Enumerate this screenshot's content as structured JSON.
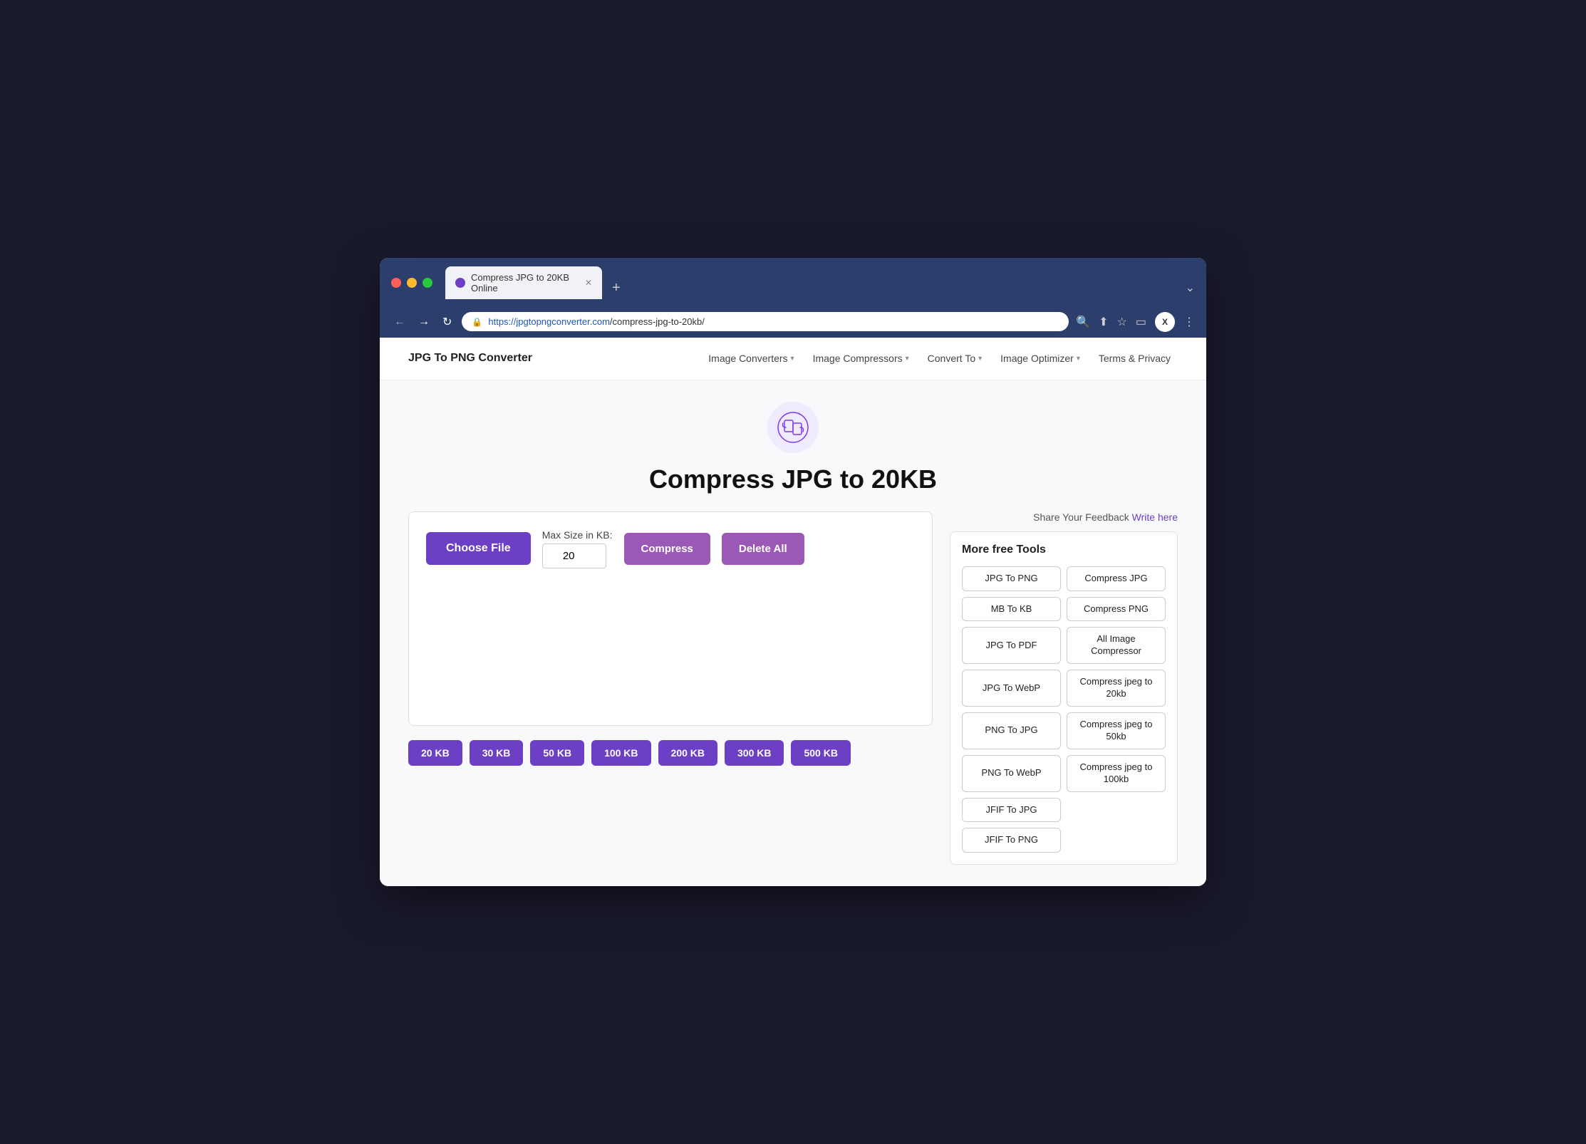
{
  "browser": {
    "tab_title": "Compress JPG to 20KB Online",
    "url_prefix": "https://jpgtopngconverter.com",
    "url_path": "/compress-jpg-to-20kb/",
    "new_tab_label": "+",
    "chevron": "⌄"
  },
  "navbar": {
    "brand": "JPG To PNG Converter",
    "menu_items": [
      {
        "label": "Image Converters",
        "has_dropdown": true
      },
      {
        "label": "Image Compressors",
        "has_dropdown": true
      },
      {
        "label": "Convert To",
        "has_dropdown": true
      },
      {
        "label": "Image Optimizer",
        "has_dropdown": true
      },
      {
        "label": "Terms & Privacy",
        "has_dropdown": false
      }
    ]
  },
  "page": {
    "title": "Compress JPG to 20KB",
    "feedback_text": "Share Your Feedback ",
    "feedback_link": "Write here"
  },
  "converter": {
    "choose_file_label": "Choose File",
    "max_size_label": "Max Size in KB:",
    "max_size_value": "20",
    "compress_label": "Compress",
    "delete_all_label": "Delete All"
  },
  "size_presets": [
    "20 KB",
    "30 KB",
    "50 KB",
    "100 KB",
    "200 KB",
    "300 KB",
    "500 KB"
  ],
  "more_tools": {
    "title": "More free Tools",
    "tools": [
      {
        "label": "JPG To PNG",
        "col": 1
      },
      {
        "label": "Compress JPG",
        "col": 2
      },
      {
        "label": "MB To KB",
        "col": 1
      },
      {
        "label": "Compress PNG",
        "col": 2
      },
      {
        "label": "JPG To PDF",
        "col": 1
      },
      {
        "label": "All Image Compressor",
        "col": 2
      },
      {
        "label": "JPG To WebP",
        "col": 1
      },
      {
        "label": "Compress jpeg to 20kb",
        "col": 2
      },
      {
        "label": "PNG To JPG",
        "col": 1
      },
      {
        "label": "Compress jpeg to 50kb",
        "col": 2
      },
      {
        "label": "PNG To WebP",
        "col": 1
      },
      {
        "label": "Compress jpeg to 100kb",
        "col": 2
      },
      {
        "label": "JFIF To JPG",
        "col": 1
      },
      {
        "label": "",
        "col": 2
      },
      {
        "label": "JFIF To PNG",
        "col": 1
      },
      {
        "label": "",
        "col": 2
      }
    ]
  }
}
